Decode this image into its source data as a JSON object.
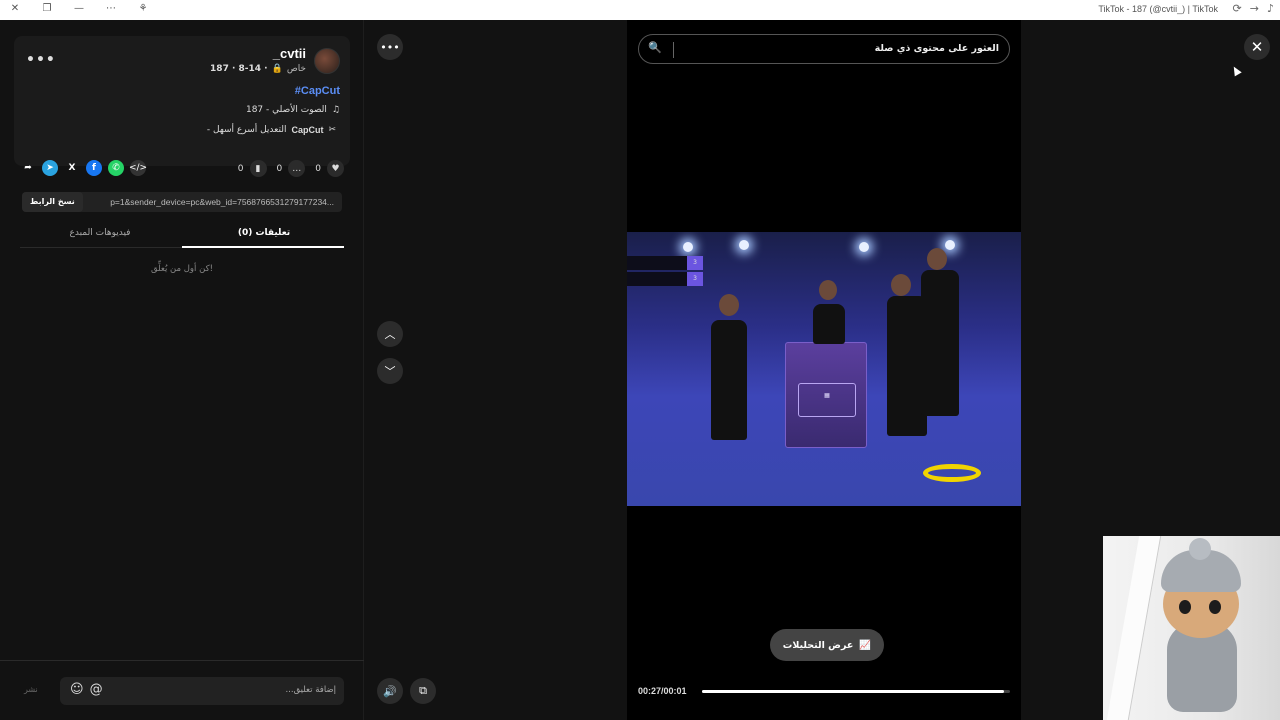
{
  "titlebar": {
    "title": "TikTok - 187 (@cvtii_) | TikTok",
    "left_icons": [
      "close-icon",
      "restore-icon",
      "minimize-icon",
      "more-icon",
      "extension-icon"
    ]
  },
  "post": {
    "username": "_cvtii",
    "privacy": "خاص",
    "date": "187 · 8-14 ·",
    "hashtag": "#CapCut",
    "music": "الصوت الأصلي - 187",
    "capcut_brand": "CapCut",
    "capcut_text": "- التعديل أسرع أسهل",
    "likes": "0",
    "comments": "0",
    "saves": "0"
  },
  "link": {
    "copy_label": "نسخ الرابط",
    "url": "p=1&sender_device=pc&web_id=7568766531279177234..."
  },
  "tabs": {
    "comments": "(0) تعليقات",
    "creator_videos": "فيديوهات المبدع"
  },
  "comments": {
    "empty": "كن أول من يُعلِّق!",
    "placeholder": "...إضافة تعليق",
    "post_label": "نشر"
  },
  "player": {
    "search_query": "العثور على محتوى ذي صلة",
    "analytics_label": "عرض التحليلات",
    "time": "00:27/00:01",
    "progress": 0.98
  },
  "colors": {
    "hashtag": "#5b8ef5",
    "telegram": "#2aa3e0",
    "facebook": "#1877f2",
    "whatsapp": "#25d366",
    "ring": "#f1d400"
  }
}
